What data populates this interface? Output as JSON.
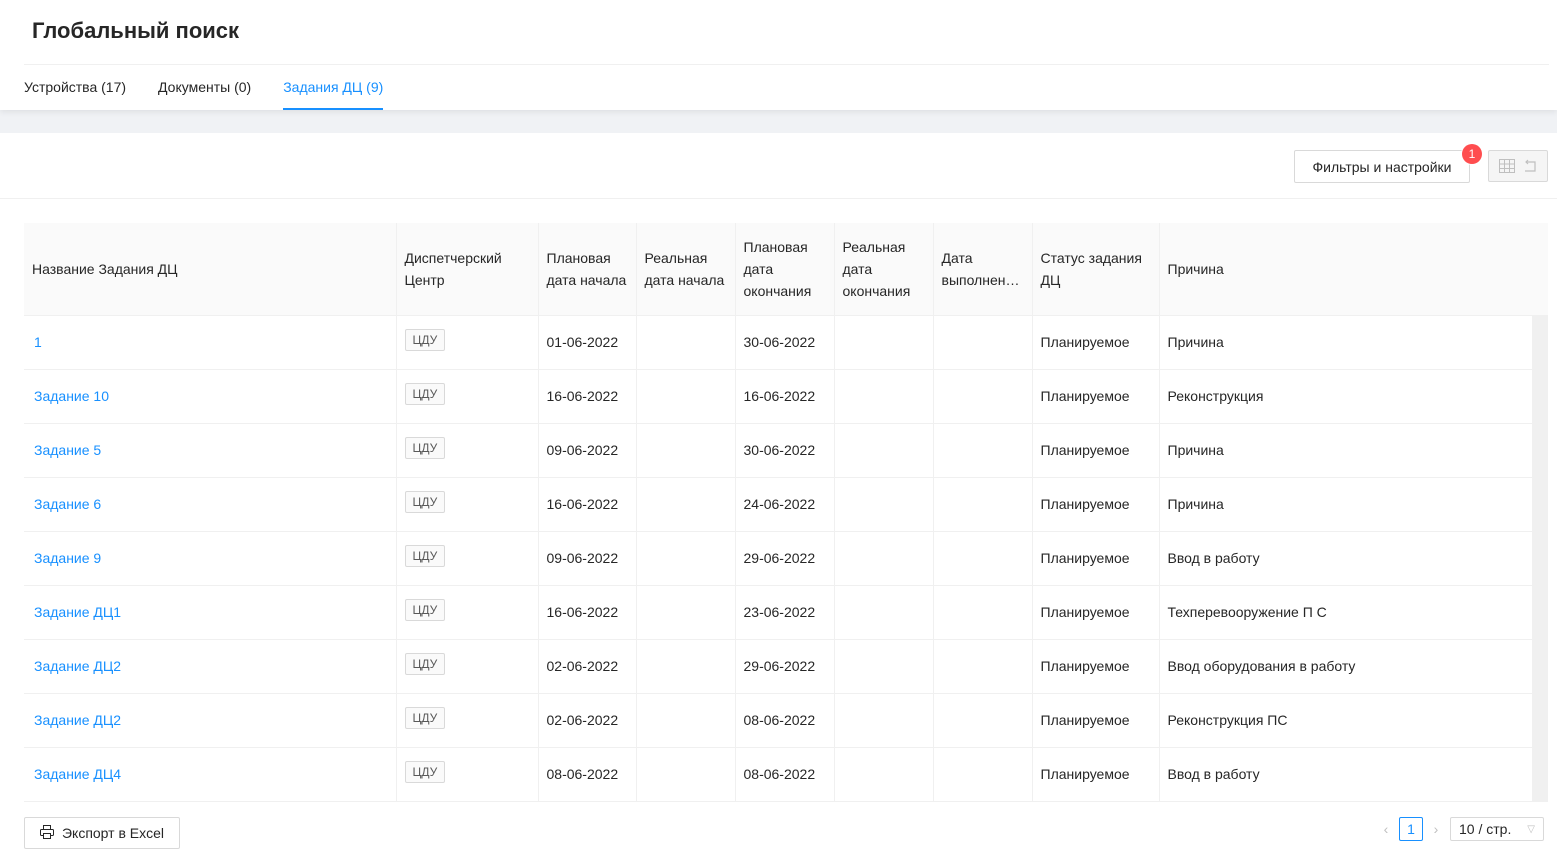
{
  "page": {
    "title": "Глобальный поиск"
  },
  "tabs": [
    {
      "label": "Устройства (17)",
      "active": false
    },
    {
      "label": "Документы (0)",
      "active": false
    },
    {
      "label": "Задания ДЦ (9)",
      "active": true
    }
  ],
  "toolbar": {
    "filters_label": "Фильтры и настройки",
    "filters_badge": "1",
    "view_icons": [
      "table-icon",
      "reset-icon"
    ]
  },
  "table": {
    "columns": [
      "Название Задания ДЦ",
      "Диспетчерский Центр",
      "Плановая дата начала",
      "Реальная дата начала",
      "Плановая дата окончания",
      "Реальная дата окончания",
      "Дата выполнен…",
      "Статус задания ДЦ",
      "Причина"
    ],
    "rows": [
      {
        "name": "1",
        "dc": "ЦДУ",
        "plan_start": "01-06-2022",
        "real_start": "",
        "plan_end": "30-06-2022",
        "real_end": "",
        "done": "",
        "status": "Планируемое",
        "reason": "Причина"
      },
      {
        "name": "Задание 10",
        "dc": "ЦДУ",
        "plan_start": "16-06-2022",
        "real_start": "",
        "plan_end": "16-06-2022",
        "real_end": "",
        "done": "",
        "status": "Планируемое",
        "reason": "Реконструкция"
      },
      {
        "name": "Задание 5",
        "dc": "ЦДУ",
        "plan_start": "09-06-2022",
        "real_start": "",
        "plan_end": "30-06-2022",
        "real_end": "",
        "done": "",
        "status": "Планируемое",
        "reason": "Причина"
      },
      {
        "name": "Задание 6",
        "dc": "ЦДУ",
        "plan_start": "16-06-2022",
        "real_start": "",
        "plan_end": "24-06-2022",
        "real_end": "",
        "done": "",
        "status": "Планируемое",
        "reason": "Причина"
      },
      {
        "name": "Задание 9",
        "dc": "ЦДУ",
        "plan_start": "09-06-2022",
        "real_start": "",
        "plan_end": "29-06-2022",
        "real_end": "",
        "done": "",
        "status": "Планируемое",
        "reason": "Ввод в работу"
      },
      {
        "name": "Задание ДЦ1",
        "dc": "ЦДУ",
        "plan_start": "16-06-2022",
        "real_start": "",
        "plan_end": "23-06-2022",
        "real_end": "",
        "done": "",
        "status": "Планируемое",
        "reason": "Техперевооружение П С"
      },
      {
        "name": "Задание ДЦ2",
        "dc": "ЦДУ",
        "plan_start": "02-06-2022",
        "real_start": "",
        "plan_end": "29-06-2022",
        "real_end": "",
        "done": "",
        "status": "Планируемое",
        "reason": "Ввод оборудования в работу"
      },
      {
        "name": "Задание ДЦ2",
        "dc": "ЦДУ",
        "plan_start": "02-06-2022",
        "real_start": "",
        "plan_end": "08-06-2022",
        "real_end": "",
        "done": "",
        "status": "Планируемое",
        "reason": "Реконструкция ПС"
      },
      {
        "name": "Задание ДЦ4",
        "dc": "ЦДУ",
        "plan_start": "08-06-2022",
        "real_start": "",
        "plan_end": "08-06-2022",
        "real_end": "",
        "done": "",
        "status": "Планируемое",
        "reason": "Ввод в работу"
      }
    ]
  },
  "footer": {
    "export_label": "Экспорт в Excel",
    "export_icon": "printer-icon",
    "current_page": "1",
    "page_size": "10 / стр."
  },
  "colors": {
    "accent": "#1890ff",
    "badge": "#ff4d4f"
  }
}
